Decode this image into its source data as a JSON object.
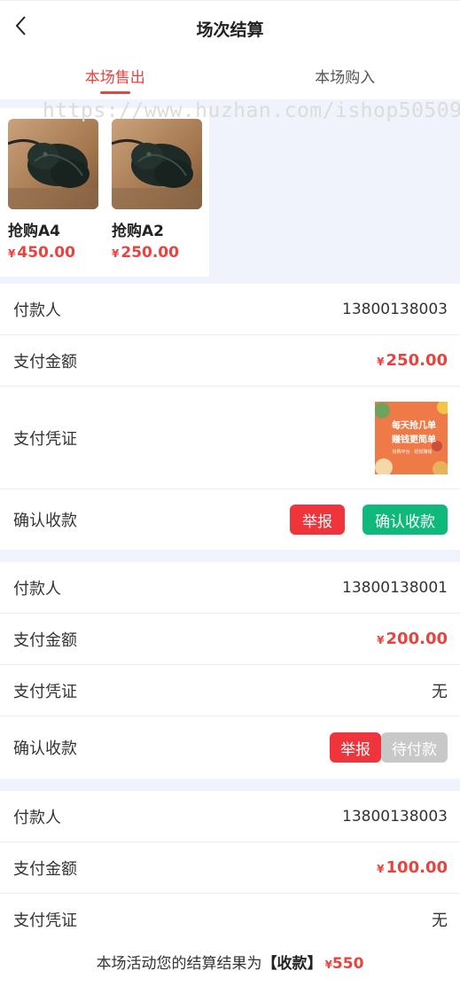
{
  "header": {
    "title": "场次结算",
    "back_icon": "chevron-left-icon"
  },
  "tabs": [
    {
      "label": "本场售出",
      "active": true
    },
    {
      "label": "本场购入",
      "active": false
    }
  ],
  "watermark": "https://www.huzhan.com/ishop50509",
  "currency": "¥",
  "products": [
    {
      "name": "抢购A4",
      "price": "450.00"
    },
    {
      "name": "抢购A2",
      "price": "250.00"
    }
  ],
  "labels": {
    "payer": "付款人",
    "amount": "支付金额",
    "voucher": "支付凭证",
    "confirm": "确认收款"
  },
  "records": [
    {
      "payer": "13800138003",
      "amount": "250.00",
      "voucher_image": {
        "line1": "每天抢几单",
        "line2": "赚钱更简单",
        "line3": "抢购平台 · 轻松赚钱"
      },
      "report_label": "举报",
      "action_label": "确认收款"
    },
    {
      "payer": "13800138001",
      "amount": "200.00",
      "voucher_text": "无",
      "report_label": "举报",
      "action_label": "待付款"
    },
    {
      "payer": "13800138003",
      "amount": "100.00",
      "voucher_text": "无"
    }
  ],
  "footer": {
    "prefix": "本场活动您的结算结果为",
    "result": "【收款】",
    "total": "550"
  },
  "colors": {
    "accent": "#e8433e",
    "confirm": "#0fb97b",
    "pending": "#c8c8c8",
    "background": "#f0f3fb"
  }
}
